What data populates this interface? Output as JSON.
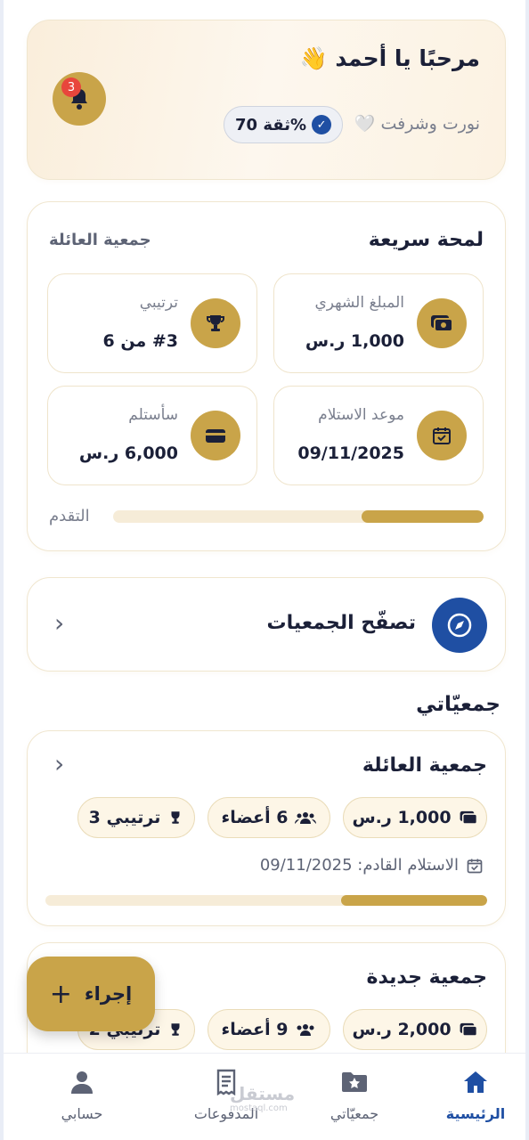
{
  "greeting": {
    "title": "مرحبًا يا أحمد",
    "wave_emoji": "👋",
    "subtitle": "نورت وشرفت",
    "heart_emoji": "🤍",
    "trust_label": "ثقة 70%",
    "notifications_count": "3"
  },
  "quick_look": {
    "title": "لمحة سريعة",
    "group_name": "جمعية العائلة",
    "stats": [
      {
        "label": "المبلغ الشهري",
        "value": "1,000 ر.س",
        "icon": "money-icon"
      },
      {
        "label": "ترتيبي",
        "value": "#3 من 6",
        "icon": "trophy-icon"
      },
      {
        "label": "موعد الاستلام",
        "value": "09/11/2025",
        "icon": "calendar-check-icon"
      },
      {
        "label": "سأستلم",
        "value": "6,000 ر.س",
        "icon": "wallet-icon"
      }
    ],
    "progress_label": "التقدم",
    "progress": 0.33
  },
  "browse": {
    "label": "تصفّح الجمعيات"
  },
  "my_groups": {
    "title": "جمعيّاتي",
    "items": [
      {
        "name": "جمعية العائلة",
        "amount": "1,000 ر.س",
        "members": "6 أعضاء",
        "rank": "ترتيبي 3",
        "next_label": "الاستلام القادم: 09/11/2025",
        "progress": 0.33
      },
      {
        "name": "جمعية جديدة",
        "amount": "2,000 ر.س",
        "members": "9 أعضاء",
        "rank": "ترتيبي 2"
      }
    ]
  },
  "fab": {
    "label": "إجراء"
  },
  "nav": {
    "home": "الرئيسية",
    "groups": "جمعيّاتي",
    "payments": "المدفوعات",
    "account": "حسابي"
  },
  "watermark": {
    "text": "مستقل",
    "sub": "mostaql.com"
  },
  "colors": {
    "gold": "#c9a449",
    "navy": "#1f4fa3",
    "text": "#1b2038",
    "cream": "#fdf6e7"
  }
}
